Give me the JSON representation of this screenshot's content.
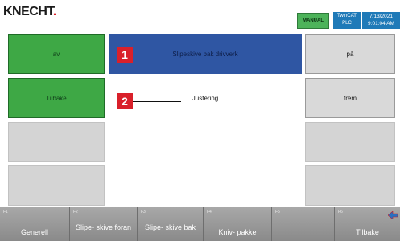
{
  "brand": {
    "name": "KNECHT",
    "dot": "."
  },
  "status": {
    "mode": "MANUAL",
    "plc_line1": "TwinCAT",
    "plc_line2": "PLC",
    "date": "7/13/2021",
    "time": "9:01:04 AM"
  },
  "rows": [
    {
      "left": "av",
      "center": "Slipeskive bak drivverk",
      "right": "på"
    },
    {
      "left": "Tilbake",
      "center": "Justering",
      "right": "frem"
    }
  ],
  "callouts": [
    "1",
    "2"
  ],
  "fkeys": [
    {
      "num": "F1",
      "label": "Generell"
    },
    {
      "num": "F2",
      "label": "Slipe- skive foran"
    },
    {
      "num": "F3",
      "label": "Slipe- skive bak"
    },
    {
      "num": "F4",
      "label": "Kniv- pakke"
    },
    {
      "num": "F5",
      "label": ""
    },
    {
      "num": "F6",
      "label": "Tilbake"
    }
  ],
  "colors": {
    "accent_blue": "#2f56a3",
    "button_green": "#3ea845",
    "status_green": "#4db35a",
    "callout_red": "#d9202a",
    "brand_red": "#d92027"
  },
  "icons": {
    "back": "back-arrow-icon"
  }
}
